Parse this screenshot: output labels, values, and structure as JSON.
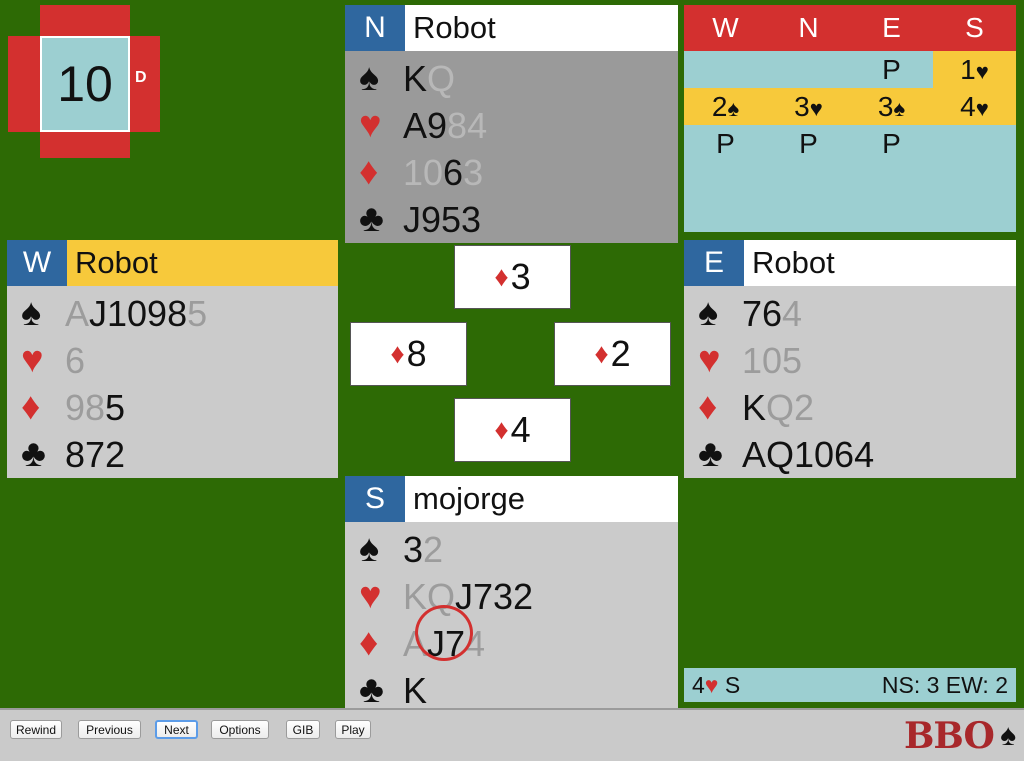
{
  "board": {
    "number": "10",
    "dealer": "D"
  },
  "north": {
    "seat": "N",
    "name": "Robot",
    "spades": [
      {
        "t": "K",
        "p": false
      },
      {
        "t": "Q",
        "p": true
      }
    ],
    "hearts": [
      {
        "t": "A9",
        "p": false
      },
      {
        "t": "84",
        "p": true
      }
    ],
    "diamonds": [
      {
        "t": "10",
        "p": true
      },
      {
        "t": "6",
        "p": false
      },
      {
        "t": "3",
        "p": true
      }
    ],
    "clubs": [
      {
        "t": "J953",
        "p": false
      }
    ]
  },
  "west": {
    "seat": "W",
    "name": "Robot",
    "spades": [
      {
        "t": "A",
        "p": true
      },
      {
        "t": "J1098",
        "p": false
      },
      {
        "t": "5",
        "p": true
      }
    ],
    "hearts": [
      {
        "t": "6",
        "p": true
      }
    ],
    "diamonds": [
      {
        "t": "98",
        "p": true
      },
      {
        "t": "5",
        "p": false
      }
    ],
    "clubs": [
      {
        "t": "872",
        "p": false
      }
    ]
  },
  "east": {
    "seat": "E",
    "name": "Robot",
    "spades": [
      {
        "t": "76",
        "p": false
      },
      {
        "t": "4",
        "p": true
      }
    ],
    "hearts": [
      {
        "t": "105",
        "p": true
      }
    ],
    "diamonds": [
      {
        "t": "K",
        "p": false
      },
      {
        "t": "Q2",
        "p": true
      }
    ],
    "clubs": [
      {
        "t": "AQ1064",
        "p": false
      }
    ]
  },
  "south": {
    "seat": "S",
    "name": "mojorge",
    "spades": [
      {
        "t": "3",
        "p": false
      },
      {
        "t": "2",
        "p": true
      }
    ],
    "hearts": [
      {
        "t": "KQ",
        "p": true
      },
      {
        "t": "J732",
        "p": false
      }
    ],
    "diamonds": [
      {
        "t": "A",
        "p": true
      },
      {
        "t": "J7",
        "p": false
      },
      {
        "t": "4",
        "p": true
      }
    ],
    "clubs": [
      {
        "t": "K",
        "p": false
      }
    ]
  },
  "suit_symbols": {
    "spades": "♠",
    "hearts": "♥",
    "diamonds": "♦",
    "clubs": "♣"
  },
  "trick": {
    "north": "3",
    "west": "8",
    "east": "2",
    "south": "4"
  },
  "bidding": {
    "headers": [
      "W",
      "N",
      "E",
      "S"
    ],
    "rows": [
      [
        "",
        "",
        "P",
        "1♥"
      ],
      [
        "2♠",
        "3♥",
        "3♠",
        "4♥"
      ],
      [
        "P",
        "P",
        "P",
        ""
      ]
    ]
  },
  "status": {
    "contract": "4♥ S",
    "score": "NS: 3 EW: 2"
  },
  "toolbar": {
    "rewind": "Rewind",
    "previous": "Previous",
    "next": "Next",
    "options": "Options",
    "gib": "GIB",
    "play": "Play"
  },
  "logo": {
    "text": "BBO"
  },
  "colors": {
    "table": "#2d6a05",
    "red": "#d3302f",
    "seat_blue": "#2f679f",
    "highlight": "#f7c93b",
    "panel": "#9ccfd1"
  }
}
